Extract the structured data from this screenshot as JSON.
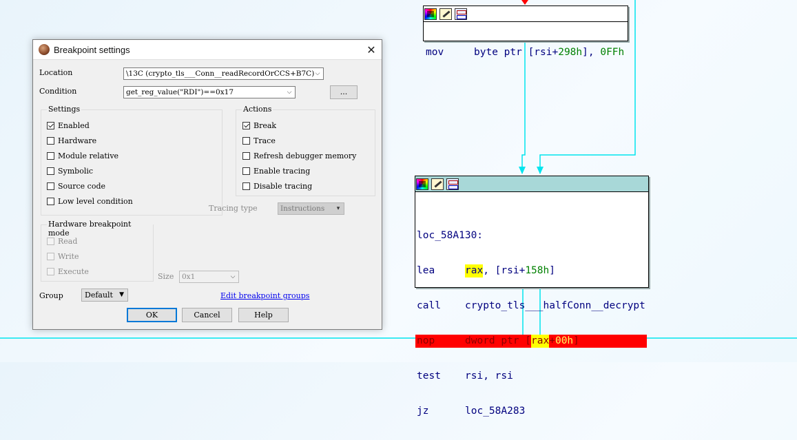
{
  "graph": {
    "top_node": {
      "lines": [
        {
          "mnemonic": "mov",
          "op_a": "byte ptr [rsi+",
          "op_num1": "298h",
          "op_b": "], ",
          "op_num2": "0FFh"
        }
      ]
    },
    "main_node": {
      "label": "loc_58A130:",
      "lines": [
        {
          "mnemonic": "lea",
          "hl": "rax",
          "rest": ", [rsi+",
          "num": "158h",
          "tail": "]"
        },
        {
          "mnemonic": "call",
          "operand": "crypto_tls___halfConn__decrypt"
        },
        {
          "mnemonic": "nop",
          "pre": "dword ptr [",
          "hl": "rax",
          "plus": "+",
          "num": "00h",
          "tail": "]"
        },
        {
          "mnemonic": "test",
          "operand": "rsi, rsi"
        },
        {
          "mnemonic": "jz",
          "operand": "loc_58A283"
        }
      ]
    },
    "colors": {
      "edge": "#00e5ee",
      "taken_edge": "#ff0000",
      "highlight": "#ffff00",
      "breakpoint_row": "#ff0000"
    }
  },
  "dialog": {
    "title": "Breakpoint settings",
    "close": "✕",
    "location_label": "Location",
    "location_value": "\\13C (crypto_tls___Conn__readRecordOrCCS+B7C)",
    "condition_label": "Condition",
    "condition_value": "get_reg_value(\"RDI\")==0x17",
    "ellipsis_button": "...",
    "settings": {
      "title": "Settings",
      "items": [
        {
          "label": "Enabled",
          "checked": true
        },
        {
          "label": "Hardware",
          "checked": false
        },
        {
          "label": "Module relative",
          "checked": false
        },
        {
          "label": "Symbolic",
          "checked": false
        },
        {
          "label": "Source code",
          "checked": false
        },
        {
          "label": "Low level condition",
          "checked": false
        }
      ]
    },
    "actions": {
      "title": "Actions",
      "items": [
        {
          "label": "Break",
          "checked": true
        },
        {
          "label": "Trace",
          "checked": false
        },
        {
          "label": "Refresh debugger memory",
          "checked": false
        },
        {
          "label": "Enable tracing",
          "checked": false
        },
        {
          "label": "Disable tracing",
          "checked": false
        }
      ]
    },
    "tracing_type_label": "Tracing type",
    "tracing_type_value": "Instructions",
    "hw_mode": {
      "title": "Hardware breakpoint mode",
      "items": [
        {
          "label": "Read",
          "checked": false
        },
        {
          "label": "Write",
          "checked": false
        },
        {
          "label": "Execute",
          "checked": false
        }
      ]
    },
    "size_label": "Size",
    "size_value": "0x1",
    "group_label": "Group",
    "group_value": "Default",
    "edit_groups_link": "Edit breakpoint groups",
    "ok": "OK",
    "cancel": "Cancel",
    "help": "Help"
  }
}
